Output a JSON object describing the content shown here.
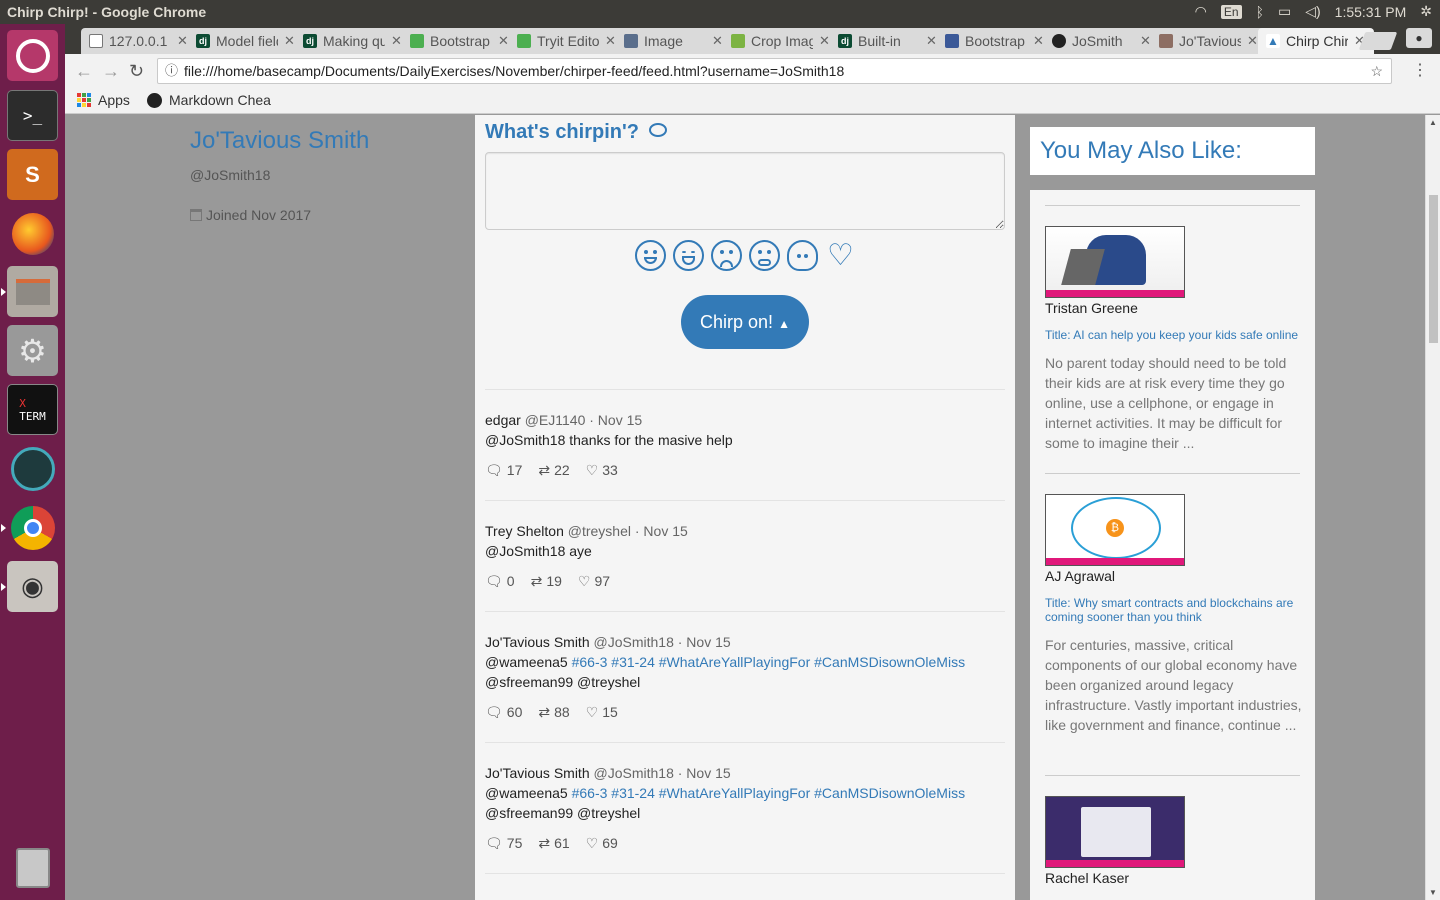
{
  "window": {
    "title": "Chirp Chirp! - Google Chrome",
    "lang": "En",
    "clock": "1:55:31 PM"
  },
  "tabs": [
    {
      "label": "127.0.0.1",
      "fav": "#888",
      "glyph": ""
    },
    {
      "label": "Model field",
      "fav": "#0c4b33",
      "glyph": "dj"
    },
    {
      "label": "Making queries",
      "fav": "#0c4b33",
      "glyph": "dj"
    },
    {
      "label": "Bootstrap",
      "fav": "#4caf50",
      "glyph": ""
    },
    {
      "label": "Tryit Editor",
      "fav": "#4caf50",
      "glyph": ""
    },
    {
      "label": "Image",
      "fav": "#5a6e8c",
      "glyph": ""
    },
    {
      "label": "Crop Image",
      "fav": "#7cb342",
      "glyph": ""
    },
    {
      "label": "Built-in",
      "fav": "#0c4b33",
      "glyph": "dj"
    },
    {
      "label": "Bootstrap",
      "fav": "#3b5998",
      "glyph": ""
    },
    {
      "label": "JoSmith",
      "fav": "#222",
      "glyph": ""
    },
    {
      "label": "Jo'Tavious",
      "fav": "#8d6e63",
      "glyph": ""
    },
    {
      "label": "Chirp Chirp!",
      "fav": "#337ab7",
      "glyph": ""
    }
  ],
  "omnibox": {
    "url": "file:///home/basecamp/Documents/DailyExercises/November/chirper-feed/feed.html?username=JoSmith18"
  },
  "bookmarks": {
    "apps": "Apps",
    "markdown": "Markdown Chea"
  },
  "profile": {
    "name": "Jo'Tavious Smith",
    "handle": "@JoSmith18",
    "joined": "Joined Nov 2017"
  },
  "compose": {
    "heading": "What's chirpin'?",
    "button": "Chirp on!"
  },
  "posts": [
    {
      "name": "edgar",
      "handle": "@EJ1140",
      "date": "· Nov 15",
      "text_pre": "@JoSmith18 thanks for the masive help",
      "tags": "",
      "text_post": "",
      "replies": "17",
      "rechirps": "22",
      "likes": "33"
    },
    {
      "name": "Trey Shelton",
      "handle": "@treyshel",
      "date": "· Nov 15",
      "text_pre": "@JoSmith18 aye",
      "tags": "",
      "text_post": "",
      "replies": "0",
      "rechirps": "19",
      "likes": "97"
    },
    {
      "name": "Jo'Tavious Smith",
      "handle": "@JoSmith18",
      "date": "· Nov 15",
      "text_pre": "@wameena5",
      "tags": "#66-3 #31-24 #WhatAreYallPlayingFor #CanMSDisownOleMiss",
      "text_post": "@sfreeman99 @treyshel",
      "replies": "60",
      "rechirps": "88",
      "likes": "15"
    },
    {
      "name": "Jo'Tavious Smith",
      "handle": "@JoSmith18",
      "date": "· Nov 15",
      "text_pre": "@wameena5",
      "tags": "#66-3 #31-24 #WhatAreYallPlayingFor #CanMSDisownOleMiss",
      "text_post": "@sfreeman99 @treyshel",
      "replies": "75",
      "rechirps": "61",
      "likes": "69"
    }
  ],
  "suggestions": {
    "heading": "You May Also Like:",
    "items": [
      {
        "author": "Tristan Greene",
        "title": "Title: AI can help you keep your kids safe online",
        "excerpt": "No parent today should need to be told their kids are at risk every time they go online, use a cellphone, or engage in internet activities. It may be difficult for some to imagine their ..."
      },
      {
        "author": "AJ Agrawal",
        "title": "Title: Why smart contracts and blockchains are coming sooner than you think",
        "excerpt": "For centuries, massive, critical components of our global economy have been organized around legacy infrastructure. Vastly important industries, like government and finance, continue ..."
      },
      {
        "author": "Rachel Kaser",
        "title": "",
        "excerpt": ""
      }
    ]
  }
}
